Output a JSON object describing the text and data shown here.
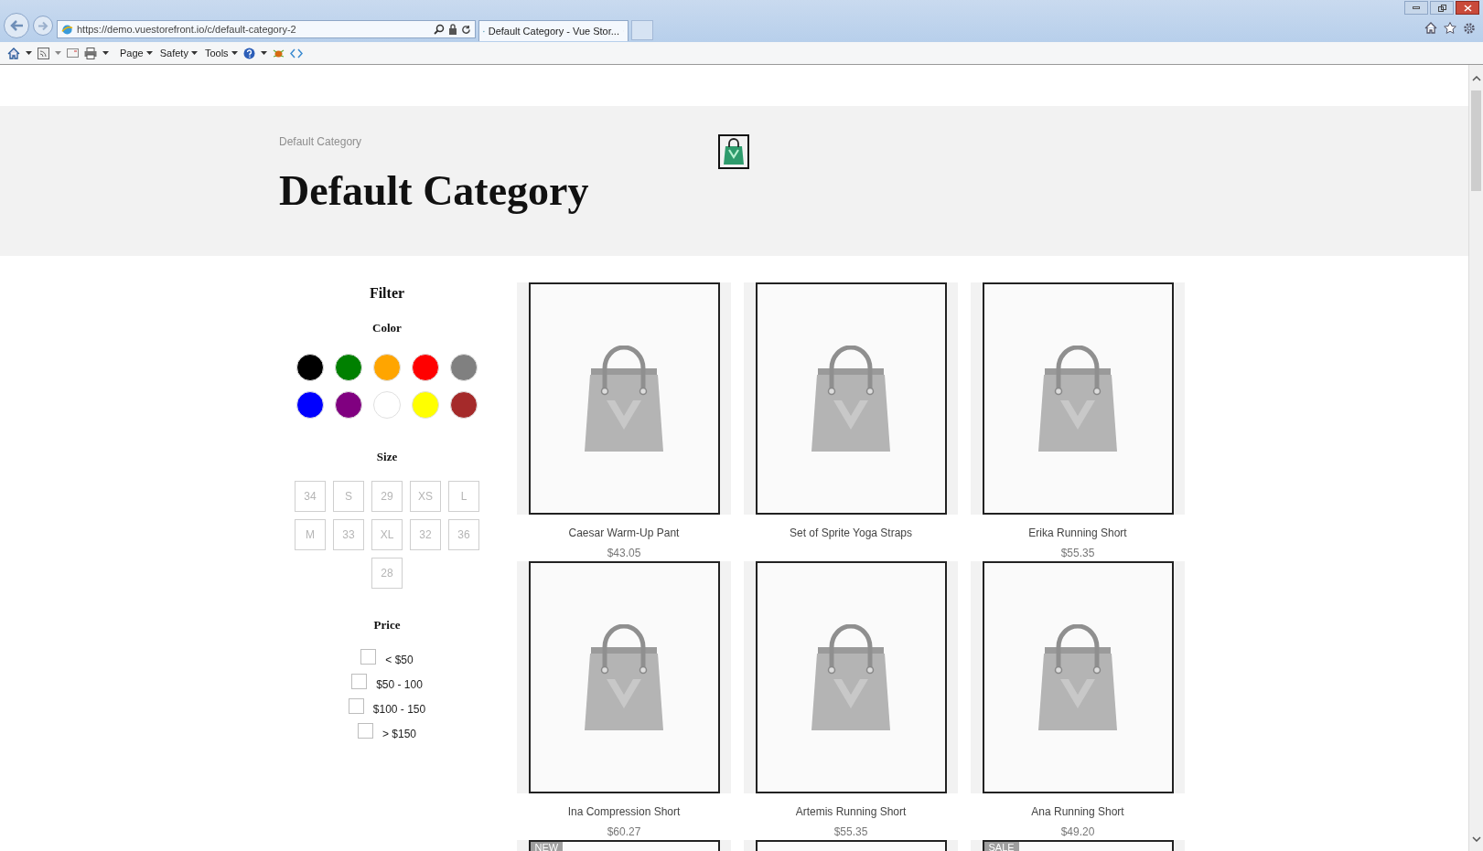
{
  "browser": {
    "url": "https://demo.vuestorefront.io/c/default-category-2",
    "tab_title": "Default Category - Vue Stor...",
    "menus": [
      "Page",
      "Safety",
      "Tools"
    ]
  },
  "breadcrumb": "Default Category",
  "title": "Default Category",
  "filter": {
    "heading": "Filter",
    "color_heading": "Color",
    "colors": [
      {
        "color": "#000000"
      },
      {
        "color": "#008000"
      },
      {
        "color": "#ffa500"
      },
      {
        "color": "#ff0000"
      },
      {
        "color": "#808080"
      },
      {
        "color": "#0000ff"
      },
      {
        "color": "#800080"
      },
      {
        "color": "#ffffff"
      },
      {
        "color": "#ffff00"
      },
      {
        "color": "#a52a2a"
      }
    ],
    "size_heading": "Size",
    "sizes": [
      "34",
      "S",
      "29",
      "XS",
      "L",
      "M",
      "33",
      "XL",
      "32",
      "36",
      "28"
    ],
    "price_heading": "Price",
    "prices": [
      {
        "label": "< $50",
        "checked": false
      },
      {
        "label": "$50 - 100",
        "checked": false
      },
      {
        "label": "$100 - 150",
        "checked": false
      },
      {
        "label": "> $150",
        "checked": false
      }
    ]
  },
  "products": [
    {
      "kind": "full",
      "name": "Caesar Warm-Up Pant",
      "price": "$43.05"
    },
    {
      "kind": "full",
      "name": "Set of Sprite Yoga Straps"
    },
    {
      "kind": "full",
      "name": "Erika Running Short",
      "price": "$55.35"
    },
    {
      "kind": "full",
      "name": "Ina Compression Short",
      "price": "$60.27"
    },
    {
      "kind": "full",
      "name": "Artemis Running Short",
      "price": "$55.35"
    },
    {
      "kind": "full",
      "name": "Ana Running Short",
      "price": "$49.20"
    },
    {
      "kind": "cut",
      "badge": "NEW"
    },
    {
      "kind": "cut"
    },
    {
      "kind": "cut",
      "badge": "SALE"
    }
  ]
}
